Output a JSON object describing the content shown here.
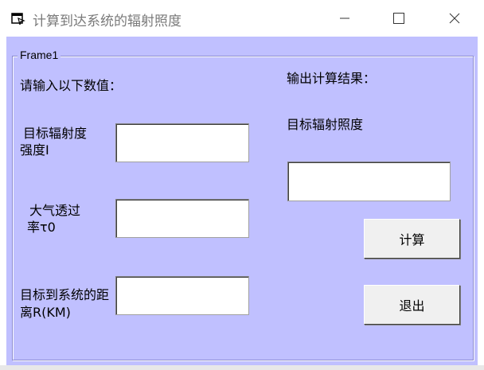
{
  "window": {
    "title": "计算到达系统的辐射照度",
    "icon": "vb-form-icon",
    "controls": [
      "minimize-icon",
      "maximize-icon",
      "close-icon"
    ]
  },
  "frame": {
    "caption": "Frame1"
  },
  "inputs": {
    "prompt": "请输入以下数值：",
    "irradiance_label_line1": "目标辐射度",
    "irradiance_label_line2": "强度I",
    "irradiance_value": "",
    "transmittance_label_line1": "大气透过",
    "transmittance_label_line2": "率τ0",
    "transmittance_value": "",
    "distance_label_line1": "目标到系统的距",
    "distance_label_line2": "离R(KM)",
    "distance_value": ""
  },
  "outputs": {
    "heading": "输出计算结果：",
    "result_label": "目标辐射照度",
    "result_value": ""
  },
  "buttons": {
    "calculate_label": "计算",
    "exit_label": "退出"
  },
  "colors": {
    "client_background": "#c0c0ff",
    "title_text": "#7a7a7a"
  }
}
